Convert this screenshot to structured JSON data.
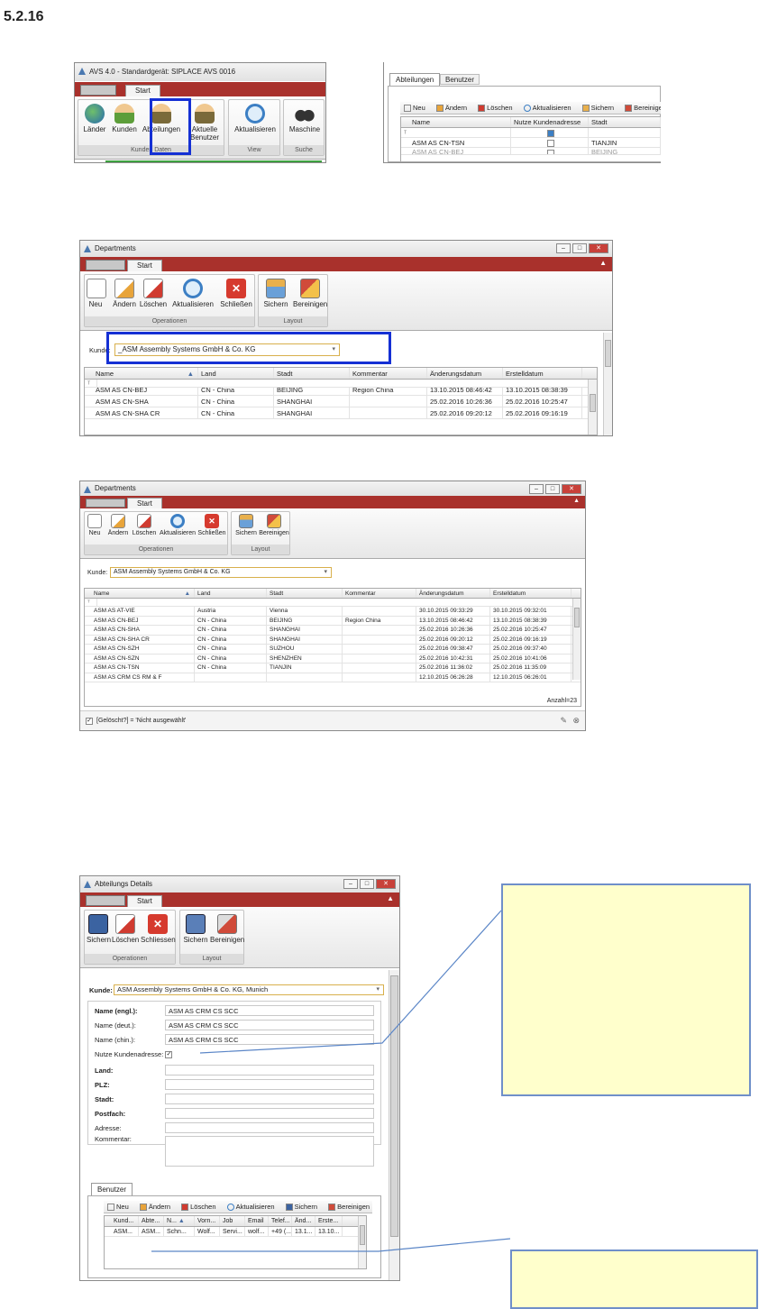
{
  "section_number": "5.2.16",
  "avs_window": {
    "title": "AVS 4.0   -   Standardgerät: SIPLACE AVS 0016",
    "tab_start": "Start",
    "buttons": [
      "Länder",
      "Kunden",
      "Abteilungen",
      "Aktuelle Benutzer",
      "Aktualisieren",
      "Maschine"
    ],
    "groups": [
      "Kunden Daten",
      "View",
      "Suche"
    ]
  },
  "tabs_panel": {
    "tabs": [
      "Abteilungen",
      "Benutzer"
    ],
    "toolbar": [
      "Neu",
      "Ändern",
      "Löschen",
      "Aktualisieren",
      "Sichern",
      "Bereinigen"
    ],
    "columns": [
      "Name",
      "Nutze Kundenadresse",
      "Stadt"
    ],
    "rows": [
      {
        "name": "ASM AS CN-TSN",
        "stadt": "TIANJIN"
      },
      {
        "name": "ASM AS CN-BEJ",
        "stadt": "BEIJING"
      }
    ]
  },
  "departments_1": {
    "title": "Departments",
    "tab_start": "Start",
    "buttons": [
      "Neu",
      "Ändern",
      "Löschen",
      "Aktualisieren",
      "Schließen"
    ],
    "layout_buttons": [
      "Sichern",
      "Bereinigen"
    ],
    "group_operationen": "Operationen",
    "group_layout": "Layout",
    "kunde_label": "Kunde:",
    "kunde_value": "_ASM Assembly Systems GmbH & Co. KG",
    "columns": [
      "Name",
      "Land",
      "Stadt",
      "Kommentar",
      "Änderungsdatum",
      "Erstelldatum"
    ],
    "rows": [
      [
        "ASM AS CN-BEJ",
        "CN - China",
        "BEIJING",
        "Region China",
        "13.10.2015 08:46:42",
        "13.10.2015 08:38:39"
      ],
      [
        "ASM AS CN-SHA",
        "CN - China",
        "SHANGHAI",
        "",
        "25.02.2016 10:26:36",
        "25.02.2016 10:25:47"
      ],
      [
        "ASM AS CN-SHA CR",
        "CN - China",
        "SHANGHAI",
        "",
        "25.02.2016 09:20:12",
        "25.02.2016 09:16:19"
      ]
    ]
  },
  "departments_2": {
    "title": "Departments",
    "tab_start": "Start",
    "buttons": [
      "Neu",
      "Ändern",
      "Löschen",
      "Aktualisieren",
      "Schließen"
    ],
    "layout_buttons": [
      "Sichern",
      "Bereinigen"
    ],
    "group_operationen": "Operationen",
    "group_layout": "Layout",
    "kunde_label": "Kunde:",
    "kunde_value": "ASM Assembly Systems GmbH & Co. KG",
    "columns": [
      "Name",
      "Land",
      "Stadt",
      "Kommentar",
      "Änderungsdatum",
      "Erstelldatum"
    ],
    "rows": [
      [
        "ASM AS AT-VIE",
        "Austria",
        "Vienna",
        "",
        "30.10.2015 09:33:29",
        "30.10.2015 09:32:01"
      ],
      [
        "ASM AS CN-BEJ",
        "CN - China",
        "BEIJING",
        "Region China",
        "13.10.2015 08:46:42",
        "13.10.2015 08:38:39"
      ],
      [
        "ASM AS CN-SHA",
        "CN - China",
        "SHANGHAI",
        "",
        "25.02.2016 10:26:36",
        "25.02.2016 10:25:47"
      ],
      [
        "ASM AS CN-SHA CR",
        "CN - China",
        "SHANGHAI",
        "",
        "25.02.2016 09:20:12",
        "25.02.2016 09:16:19"
      ],
      [
        "ASM AS CN-SZH",
        "CN - China",
        "SUZHOU",
        "",
        "25.02.2016 09:38:47",
        "25.02.2016 09:37:40"
      ],
      [
        "ASM AS CN-SZN",
        "CN - China",
        "SHENZHEN",
        "",
        "25.02.2016 10:42:31",
        "25.02.2016 10:41:06"
      ],
      [
        "ASM AS CN-TSN",
        "CN - China",
        "TIANJIN",
        "",
        "25.02.2016 11:36:02",
        "25.02.2016 11:35:09"
      ],
      [
        "ASM AS CRM CS RM & F",
        "",
        "",
        "",
        "12.10.2015 06:26:28",
        "12.10.2015 06:26:01"
      ]
    ],
    "count": "Anzahl=23",
    "filter": "[Gelöscht?] = 'Nicht ausgewählt'"
  },
  "details": {
    "title": "Abteilungs Details",
    "tab_start": "Start",
    "buttons": [
      "Sichern",
      "Löschen",
      "Schliessen"
    ],
    "layout_buttons": [
      "Sichern",
      "Bereinigen"
    ],
    "group_operationen": "Operationen",
    "group_layout": "Layout",
    "kunde_label": "Kunde:",
    "kunde_value": "ASM Assembly Systems GmbH & Co. KG, Munich",
    "fields": [
      {
        "label": "Name (engl.):",
        "value": "ASM AS CRM CS SCC"
      },
      {
        "label": "Name (deut.):",
        "value": "ASM AS CRM CS SCC"
      },
      {
        "label": "Name (chin.):",
        "value": "ASM AS CRM CS SCC"
      }
    ],
    "nutze_label": "Nutze Kundenadresse:",
    "address_labels": [
      "Land:",
      "PLZ:",
      "Stadt:",
      "Postfach:",
      "Adresse:"
    ],
    "kommentar_label": "Kommentar:",
    "benutzer_tab": "Benutzer",
    "toolbar": [
      "Neu",
      "Ändern",
      "Löschen",
      "Aktualisieren",
      "Sichern",
      "Bereinigen"
    ],
    "columns": [
      "Kund...",
      "Abte...",
      "N...",
      "Vorn...",
      "Job",
      "Email",
      "Telef...",
      "Änd...",
      "Erste..."
    ],
    "row": [
      "ASM...",
      "ASM...",
      "Schn...",
      "Wolf...",
      "Servi...",
      "wolf...",
      "+49 (...",
      "13.1...",
      "13.10..."
    ]
  }
}
